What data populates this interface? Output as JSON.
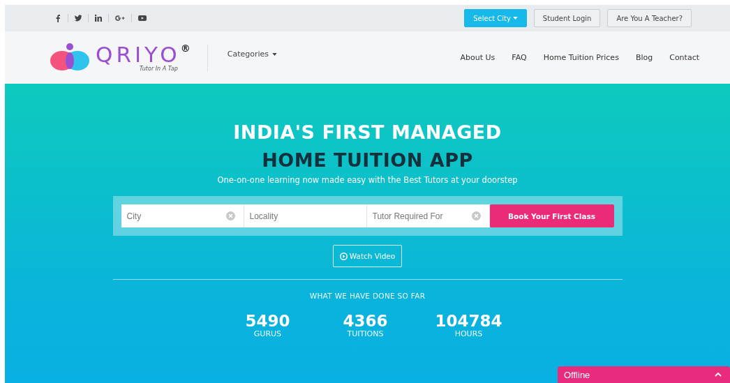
{
  "top_bar": {
    "social": [
      {
        "kind": "facebook"
      },
      {
        "kind": "twitter"
      },
      {
        "kind": "linkedin"
      },
      {
        "kind": "googleplus"
      },
      {
        "kind": "youtube"
      }
    ],
    "buttons": [
      {
        "label": "Select City",
        "kind": "dropdown"
      },
      {
        "label": "Student Login",
        "kind": "outline"
      },
      {
        "label": "Are You A Teacher?",
        "kind": "outline"
      }
    ]
  },
  "header": {
    "logo": {
      "name": "QRIYO",
      "mark": "®",
      "tagline": "Tutor In A Tap"
    },
    "categories": "Categories",
    "nav": [
      "About Us",
      "FAQ",
      "Home Tuition Prices",
      "Blog",
      "Contact"
    ]
  },
  "hero": {
    "title_line_1": "INDIA'S FIRST MANAGED",
    "title_line_2": "HOME TUITION APP",
    "subtitle": "One-on-one learning now made easy with the Best Tutors at your doorstep",
    "fields": [
      {
        "placeholder": "City",
        "clearable": true
      },
      {
        "placeholder": "Locality",
        "clearable": false
      },
      {
        "placeholder": "Tutor Required For",
        "clearable": true
      }
    ],
    "book_button": "Book Your First Class",
    "watch_button": "Watch Video",
    "stats_heading": "WHAT WE HAVE DONE SO FAR",
    "stats": [
      {
        "value": "5490",
        "label": "GURUS"
      },
      {
        "value": "4366",
        "label": "TUITIONS"
      },
      {
        "value": "104784",
        "label": "HOURS"
      }
    ]
  },
  "chat": {
    "status": "Offline",
    "expanded": false
  }
}
